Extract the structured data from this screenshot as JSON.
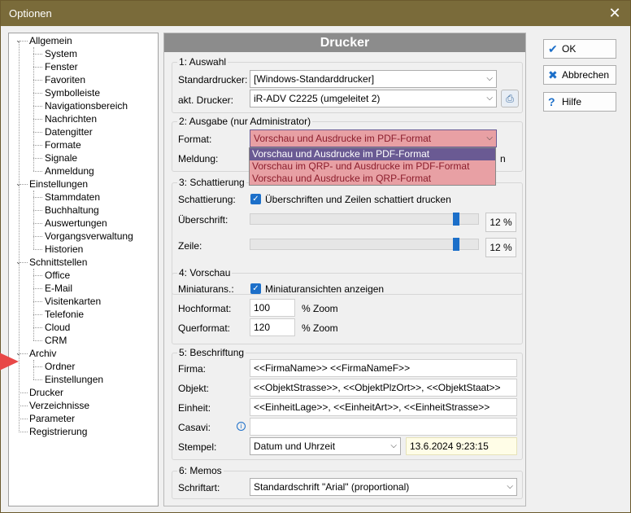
{
  "window": {
    "title": "Optionen",
    "close_glyph": "✕"
  },
  "tree": {
    "items": [
      {
        "label": "Allgemein",
        "level": 0,
        "expand": "−"
      },
      {
        "label": "System",
        "level": 1
      },
      {
        "label": "Fenster",
        "level": 1
      },
      {
        "label": "Favoriten",
        "level": 1
      },
      {
        "label": "Symbolleiste",
        "level": 1
      },
      {
        "label": "Navigationsbereich",
        "level": 1
      },
      {
        "label": "Nachrichten",
        "level": 1
      },
      {
        "label": "Datengitter",
        "level": 1
      },
      {
        "label": "Formate",
        "level": 1
      },
      {
        "label": "Signale",
        "level": 1
      },
      {
        "label": "Anmeldung",
        "level": 1
      },
      {
        "label": "Einstellungen",
        "level": 0,
        "expand": "−"
      },
      {
        "label": "Stammdaten",
        "level": 1
      },
      {
        "label": "Buchhaltung",
        "level": 1
      },
      {
        "label": "Auswertungen",
        "level": 1
      },
      {
        "label": "Vorgangsverwaltung",
        "level": 1
      },
      {
        "label": "Historien",
        "level": 1
      },
      {
        "label": "Schnittstellen",
        "level": 0,
        "expand": "−"
      },
      {
        "label": "Office",
        "level": 1
      },
      {
        "label": "E-Mail",
        "level": 1
      },
      {
        "label": "Visitenkarten",
        "level": 1
      },
      {
        "label": "Telefonie",
        "level": 1
      },
      {
        "label": "Cloud",
        "level": 1
      },
      {
        "label": "CRM",
        "level": 1
      },
      {
        "label": "Archiv",
        "level": 0,
        "expand": "−"
      },
      {
        "label": "Ordner",
        "level": 1
      },
      {
        "label": "Einstellungen",
        "level": 1
      },
      {
        "label": "Drucker",
        "level": 0,
        "selected": true
      },
      {
        "label": "Verzeichnisse",
        "level": 0
      },
      {
        "label": "Parameter",
        "level": 0
      },
      {
        "label": "Registrierung",
        "level": 0
      }
    ]
  },
  "panel": {
    "title": "Drucker",
    "auswahl": {
      "group_label": "1: Auswahl",
      "standard_label": "Standardrucker:",
      "standard_value": "[Windows-Standarddrucker]",
      "akt_label": "akt. Drucker:",
      "akt_value": "iR-ADV C2225 (umgeleitet 2)"
    },
    "ausgabe": {
      "group_label": "2: Ausgabe  (nur Administrator)",
      "format_label": "Format:",
      "format_value": "Vorschau und Ausdrucke im PDF-Format",
      "meldung_label": "Meldung:",
      "meldung_tail": "n",
      "options": [
        "Vorschau und Ausdrucke im PDF-Format",
        "Vorschau im QRP- und Ausdrucke im PDF-Format",
        "Vorschau und Ausdrucke im QRP-Format"
      ]
    },
    "schattierung": {
      "group_label": "3: Schattierung",
      "label": "Schattierung:",
      "check_label": "Überschriften und Zeilen schattiert drucken",
      "ueberschrift_label": "Überschrift:",
      "ueberschrift_value": "12 %",
      "ueberschrift_level": 0.9,
      "zeile_label": "Zeile:",
      "zeile_value": "12 %",
      "zeile_level": 0.9
    },
    "vorschau": {
      "group_label": "4: Vorschau",
      "mini_label": "Miniaturans.:",
      "mini_check_label": "Miniaturansichten anzeigen",
      "hoch_label": "Hochformat:",
      "hoch_value": "100",
      "hoch_unit": "% Zoom",
      "quer_label": "Querformat:",
      "quer_value": "120",
      "quer_unit": "% Zoom"
    },
    "beschriftung": {
      "group_label": "5: Beschriftung",
      "firma_label": "Firma:",
      "firma_value": "<<FirmaName>> <<FirmaNameF>>",
      "objekt_label": "Objekt:",
      "objekt_value": "<<ObjektStrasse>>, <<ObjektPlzOrt>>, <<ObjektStaat>>",
      "einheit_label": "Einheit:",
      "einheit_value": "<<EinheitLage>>, <<EinheitArt>>, <<EinheitStrasse>>",
      "casavi_label": "Casavi:",
      "casavi_value": "",
      "stempel_label": "Stempel:",
      "stempel_value": "Datum und Uhrzeit",
      "stempel_preview": "13.6.2024 9:23:15"
    },
    "memos": {
      "group_label": "6: Memos",
      "schrift_label": "Schriftart:",
      "schrift_value": "Standardschrift \"Arial\" (proportional)"
    }
  },
  "buttons": {
    "ok": "OK",
    "abbrechen": "Abbrechen",
    "hilfe": "Hilfe"
  },
  "colors": {
    "accent": "#1c6fc9",
    "titlebar": "#7a6b3a",
    "dropdown_bg": "#e8a0a4",
    "dropdown_sel": "#6a5a93"
  }
}
